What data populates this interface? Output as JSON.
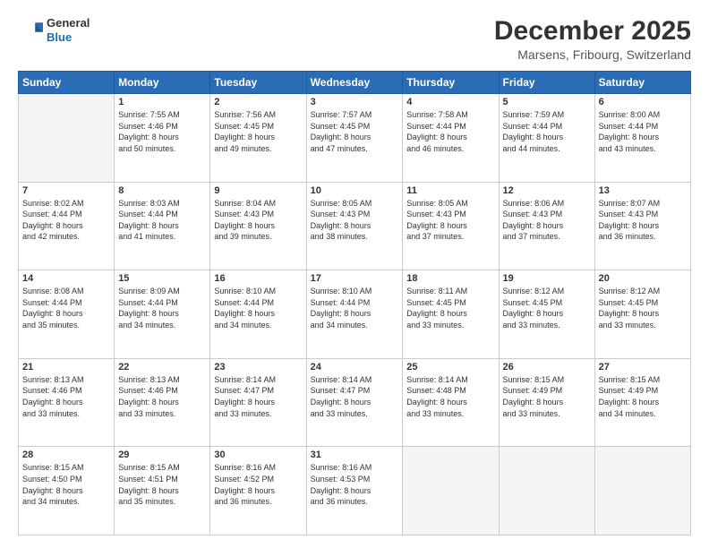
{
  "logo": {
    "line1": "General",
    "line2": "Blue"
  },
  "header": {
    "month": "December 2025",
    "location": "Marsens, Fribourg, Switzerland"
  },
  "weekdays": [
    "Sunday",
    "Monday",
    "Tuesday",
    "Wednesday",
    "Thursday",
    "Friday",
    "Saturday"
  ],
  "weeks": [
    [
      {
        "day": "",
        "info": ""
      },
      {
        "day": "1",
        "info": "Sunrise: 7:55 AM\nSunset: 4:46 PM\nDaylight: 8 hours\nand 50 minutes."
      },
      {
        "day": "2",
        "info": "Sunrise: 7:56 AM\nSunset: 4:45 PM\nDaylight: 8 hours\nand 49 minutes."
      },
      {
        "day": "3",
        "info": "Sunrise: 7:57 AM\nSunset: 4:45 PM\nDaylight: 8 hours\nand 47 minutes."
      },
      {
        "day": "4",
        "info": "Sunrise: 7:58 AM\nSunset: 4:44 PM\nDaylight: 8 hours\nand 46 minutes."
      },
      {
        "day": "5",
        "info": "Sunrise: 7:59 AM\nSunset: 4:44 PM\nDaylight: 8 hours\nand 44 minutes."
      },
      {
        "day": "6",
        "info": "Sunrise: 8:00 AM\nSunset: 4:44 PM\nDaylight: 8 hours\nand 43 minutes."
      }
    ],
    [
      {
        "day": "7",
        "info": "Sunrise: 8:02 AM\nSunset: 4:44 PM\nDaylight: 8 hours\nand 42 minutes."
      },
      {
        "day": "8",
        "info": "Sunrise: 8:03 AM\nSunset: 4:44 PM\nDaylight: 8 hours\nand 41 minutes."
      },
      {
        "day": "9",
        "info": "Sunrise: 8:04 AM\nSunset: 4:43 PM\nDaylight: 8 hours\nand 39 minutes."
      },
      {
        "day": "10",
        "info": "Sunrise: 8:05 AM\nSunset: 4:43 PM\nDaylight: 8 hours\nand 38 minutes."
      },
      {
        "day": "11",
        "info": "Sunrise: 8:05 AM\nSunset: 4:43 PM\nDaylight: 8 hours\nand 37 minutes."
      },
      {
        "day": "12",
        "info": "Sunrise: 8:06 AM\nSunset: 4:43 PM\nDaylight: 8 hours\nand 37 minutes."
      },
      {
        "day": "13",
        "info": "Sunrise: 8:07 AM\nSunset: 4:43 PM\nDaylight: 8 hours\nand 36 minutes."
      }
    ],
    [
      {
        "day": "14",
        "info": "Sunrise: 8:08 AM\nSunset: 4:44 PM\nDaylight: 8 hours\nand 35 minutes."
      },
      {
        "day": "15",
        "info": "Sunrise: 8:09 AM\nSunset: 4:44 PM\nDaylight: 8 hours\nand 34 minutes."
      },
      {
        "day": "16",
        "info": "Sunrise: 8:10 AM\nSunset: 4:44 PM\nDaylight: 8 hours\nand 34 minutes."
      },
      {
        "day": "17",
        "info": "Sunrise: 8:10 AM\nSunset: 4:44 PM\nDaylight: 8 hours\nand 34 minutes."
      },
      {
        "day": "18",
        "info": "Sunrise: 8:11 AM\nSunset: 4:45 PM\nDaylight: 8 hours\nand 33 minutes."
      },
      {
        "day": "19",
        "info": "Sunrise: 8:12 AM\nSunset: 4:45 PM\nDaylight: 8 hours\nand 33 minutes."
      },
      {
        "day": "20",
        "info": "Sunrise: 8:12 AM\nSunset: 4:45 PM\nDaylight: 8 hours\nand 33 minutes."
      }
    ],
    [
      {
        "day": "21",
        "info": "Sunrise: 8:13 AM\nSunset: 4:46 PM\nDaylight: 8 hours\nand 33 minutes."
      },
      {
        "day": "22",
        "info": "Sunrise: 8:13 AM\nSunset: 4:46 PM\nDaylight: 8 hours\nand 33 minutes."
      },
      {
        "day": "23",
        "info": "Sunrise: 8:14 AM\nSunset: 4:47 PM\nDaylight: 8 hours\nand 33 minutes."
      },
      {
        "day": "24",
        "info": "Sunrise: 8:14 AM\nSunset: 4:47 PM\nDaylight: 8 hours\nand 33 minutes."
      },
      {
        "day": "25",
        "info": "Sunrise: 8:14 AM\nSunset: 4:48 PM\nDaylight: 8 hours\nand 33 minutes."
      },
      {
        "day": "26",
        "info": "Sunrise: 8:15 AM\nSunset: 4:49 PM\nDaylight: 8 hours\nand 33 minutes."
      },
      {
        "day": "27",
        "info": "Sunrise: 8:15 AM\nSunset: 4:49 PM\nDaylight: 8 hours\nand 34 minutes."
      }
    ],
    [
      {
        "day": "28",
        "info": "Sunrise: 8:15 AM\nSunset: 4:50 PM\nDaylight: 8 hours\nand 34 minutes."
      },
      {
        "day": "29",
        "info": "Sunrise: 8:15 AM\nSunset: 4:51 PM\nDaylight: 8 hours\nand 35 minutes."
      },
      {
        "day": "30",
        "info": "Sunrise: 8:16 AM\nSunset: 4:52 PM\nDaylight: 8 hours\nand 36 minutes."
      },
      {
        "day": "31",
        "info": "Sunrise: 8:16 AM\nSunset: 4:53 PM\nDaylight: 8 hours\nand 36 minutes."
      },
      {
        "day": "",
        "info": ""
      },
      {
        "day": "",
        "info": ""
      },
      {
        "day": "",
        "info": ""
      }
    ]
  ]
}
